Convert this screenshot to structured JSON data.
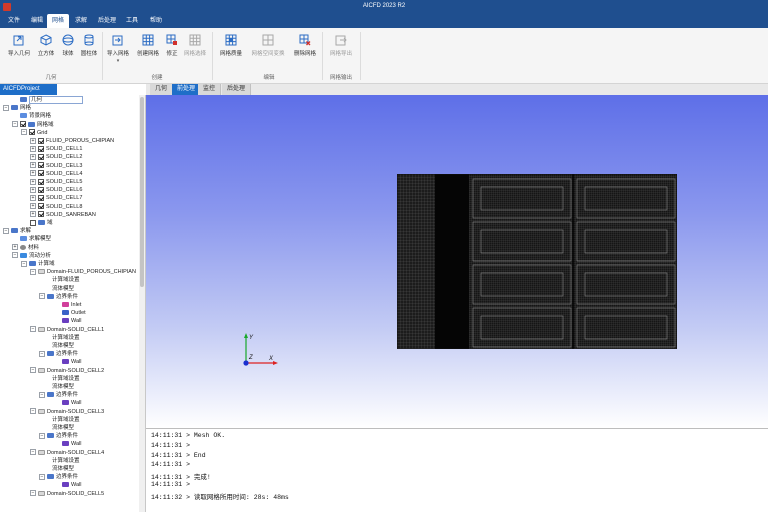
{
  "window": {
    "title": "AICFD 2023 R2"
  },
  "menu": [
    {
      "label": "文件",
      "active": false
    },
    {
      "label": "编辑",
      "active": false
    },
    {
      "label": "网格",
      "active": true
    },
    {
      "label": "求解",
      "active": false
    },
    {
      "label": "后处理",
      "active": false
    },
    {
      "label": "工具",
      "active": false
    },
    {
      "label": "帮助",
      "active": false
    }
  ],
  "ribbon": {
    "groups": [
      {
        "label": "几何",
        "buttons": [
          {
            "label": "导入几何",
            "icon": "import-geometry-icon",
            "disabled": false
          },
          {
            "label": "立方体",
            "icon": "cube-icon",
            "disabled": false
          },
          {
            "label": "球体",
            "icon": "sphere-icon",
            "disabled": false
          },
          {
            "label": "圆柱体",
            "icon": "cylinder-icon",
            "disabled": false
          }
        ]
      },
      {
        "label": "创建",
        "buttons": [
          {
            "label": "导入网格",
            "icon": "import-mesh-icon",
            "disabled": false,
            "dropdown": true
          },
          {
            "label": "创建网格",
            "icon": "create-mesh-icon",
            "disabled": false
          },
          {
            "label": "修正",
            "icon": "fix-mesh-icon",
            "disabled": false
          },
          {
            "label": "网格选择",
            "icon": "mesh-select-icon",
            "disabled": true
          }
        ]
      },
      {
        "label": "编辑",
        "buttons": [
          {
            "label": "网格质量",
            "icon": "mesh-quality-icon",
            "disabled": false
          },
          {
            "label": "网格空间变换",
            "icon": "mesh-transform-icon",
            "disabled": true
          },
          {
            "label": "删除网格",
            "icon": "delete-mesh-icon",
            "disabled": false
          }
        ]
      },
      {
        "label": "网格输出",
        "buttons": [
          {
            "label": "网格导出",
            "icon": "export-mesh-icon",
            "disabled": true
          }
        ]
      }
    ]
  },
  "project": {
    "tab_label": "AICFDProject",
    "tree": [
      {
        "label": "几何",
        "depth": 1,
        "icon": "folder",
        "selected": true
      },
      {
        "label": "网格",
        "depth": 0,
        "expander": "-",
        "icon": "folder"
      },
      {
        "label": "背景网格",
        "depth": 1,
        "icon": "db"
      },
      {
        "label": "网格域",
        "depth": 1,
        "expander": "-",
        "check": true,
        "icon": "folder"
      },
      {
        "label": "Grid",
        "depth": 2,
        "expander": "-",
        "check": true
      },
      {
        "label": "FLUID_POROUS_CHIPIAN",
        "depth": 3,
        "expander": "+",
        "check": true
      },
      {
        "label": "SOLID_CELL1",
        "depth": 3,
        "expander": "+",
        "check": true
      },
      {
        "label": "SOLID_CELL2",
        "depth": 3,
        "expander": "+",
        "check": true
      },
      {
        "label": "SOLID_CELL3",
        "depth": 3,
        "expander": "+",
        "check": true
      },
      {
        "label": "SOLID_CELL4",
        "depth": 3,
        "expander": "+",
        "check": true
      },
      {
        "label": "SOLID_CELL5",
        "depth": 3,
        "expander": "+",
        "check": true
      },
      {
        "label": "SOLID_CELL6",
        "depth": 3,
        "expander": "+",
        "check": true
      },
      {
        "label": "SOLID_CELL7",
        "depth": 3,
        "expander": "+",
        "check": true
      },
      {
        "label": "SOLID_CELL8",
        "depth": 3,
        "expander": "+",
        "check": true
      },
      {
        "label": "SOLID_SANREBAN",
        "depth": 3,
        "expander": "+",
        "check": true
      },
      {
        "label": "域",
        "depth": 2,
        "check": false,
        "icon": "folder"
      },
      {
        "label": "求解",
        "depth": 0,
        "expander": "-",
        "icon": "folder"
      },
      {
        "label": "求解模型",
        "depth": 1,
        "icon": "db"
      },
      {
        "label": "材料",
        "depth": 1,
        "expander": "+",
        "icon": "material"
      },
      {
        "label": "流动分析",
        "depth": 1,
        "expander": "-",
        "icon": "flow"
      },
      {
        "label": "计算域",
        "depth": 2,
        "expander": "-",
        "icon": "folder"
      },
      {
        "label": "Domain-FLUID_POROUS_CHIPIAN",
        "depth": 3,
        "expander": "-",
        "icon": "domain"
      },
      {
        "label": "计算域设置",
        "depth": 4
      },
      {
        "label": "流体模型",
        "depth": 4
      },
      {
        "label": "边界条件",
        "depth": 4,
        "expander": "-",
        "icon": "folder"
      },
      {
        "label": "Inlet",
        "depth": 5,
        "icon": "bc-inlet"
      },
      {
        "label": "Outlet",
        "depth": 5,
        "icon": "bc-outlet"
      },
      {
        "label": "Wall",
        "depth": 5,
        "icon": "bc-wall"
      },
      {
        "label": "Domain-SOLID_CELL1",
        "depth": 3,
        "expander": "-",
        "icon": "domain"
      },
      {
        "label": "计算域设置",
        "depth": 4
      },
      {
        "label": "流体模型",
        "depth": 4
      },
      {
        "label": "边界条件",
        "depth": 4,
        "expander": "-",
        "icon": "folder"
      },
      {
        "label": "Wall",
        "depth": 5,
        "icon": "bc-wall"
      },
      {
        "label": "Domain-SOLID_CELL2",
        "depth": 3,
        "expander": "-",
        "icon": "domain"
      },
      {
        "label": "计算域设置",
        "depth": 4
      },
      {
        "label": "流体模型",
        "depth": 4
      },
      {
        "label": "边界条件",
        "depth": 4,
        "expander": "-",
        "icon": "folder"
      },
      {
        "label": "Wall",
        "depth": 5,
        "icon": "bc-wall"
      },
      {
        "label": "Domain-SOLID_CELL3",
        "depth": 3,
        "expander": "-",
        "icon": "domain"
      },
      {
        "label": "计算域设置",
        "depth": 4
      },
      {
        "label": "流体模型",
        "depth": 4
      },
      {
        "label": "边界条件",
        "depth": 4,
        "expander": "-",
        "icon": "folder"
      },
      {
        "label": "Wall",
        "depth": 5,
        "icon": "bc-wall"
      },
      {
        "label": "Domain-SOLID_CELL4",
        "depth": 3,
        "expander": "-",
        "icon": "domain"
      },
      {
        "label": "计算域设置",
        "depth": 4
      },
      {
        "label": "流体模型",
        "depth": 4
      },
      {
        "label": "边界条件",
        "depth": 4,
        "expander": "-",
        "icon": "folder"
      },
      {
        "label": "Wall",
        "depth": 5,
        "icon": "bc-wall"
      },
      {
        "label": "Domain-SOLID_CELL5",
        "depth": 3,
        "expander": "-",
        "icon": "domain"
      }
    ]
  },
  "viewport": {
    "tabs": [
      {
        "label": "几何",
        "active": false
      },
      {
        "label": "前处理",
        "active": true
      },
      {
        "label": "监控",
        "active": false
      },
      {
        "label": "后处理",
        "active": false
      }
    ],
    "axis_labels": {
      "y": "Y",
      "z": "Z",
      "x": "X"
    }
  },
  "console": {
    "lines": [
      "14:11:31 > Mesh OK.",
      "14:11:31 >",
      "14:11:31 > End",
      "14:11:31 >",
      "14:11:31 > 完成!",
      "14:11:31 >",
      "14:11:32 > 读取网格所用时间: 28s: 48ms"
    ]
  }
}
